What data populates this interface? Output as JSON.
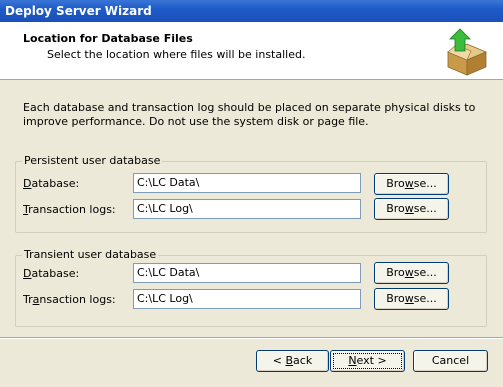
{
  "window": {
    "title": "Deploy Server Wizard"
  },
  "header": {
    "title": "Location for Database Files",
    "subtitle": "Select the location where files will be installed.",
    "icon": "box-with-green-arrow-icon"
  },
  "intro": "Each database and transaction log should be placed on separate physical disks to improve performance. Do not use the system disk or page file.",
  "persistent": {
    "legend": "Persistent user database",
    "database_label_u": "D",
    "database_label_rest": "atabase:",
    "database_value": "C:\\LC Data\\",
    "logs_label_u": "T",
    "logs_label_rest": "ransaction logs:",
    "logs_value": "C:\\LC Log\\",
    "browse_pre": "Bro",
    "browse_u": "w",
    "browse_post": "se..."
  },
  "transient": {
    "legend": "Transient user database",
    "database_label_u": "D",
    "database_label_rest": "atabase:",
    "database_value": "C:\\LC Data\\",
    "logs_label_pre": "Tr",
    "logs_label_u": "a",
    "logs_label_rest": "nsaction logs:",
    "logs_value": "C:\\LC Log\\",
    "browse_pre": "Bro",
    "browse_u": "w",
    "browse_post": "se..."
  },
  "nav": {
    "back_arrow": "< ",
    "back_u": "B",
    "back_rest": "ack",
    "next_u": "N",
    "next_rest": "ext >",
    "cancel": "Cancel"
  }
}
